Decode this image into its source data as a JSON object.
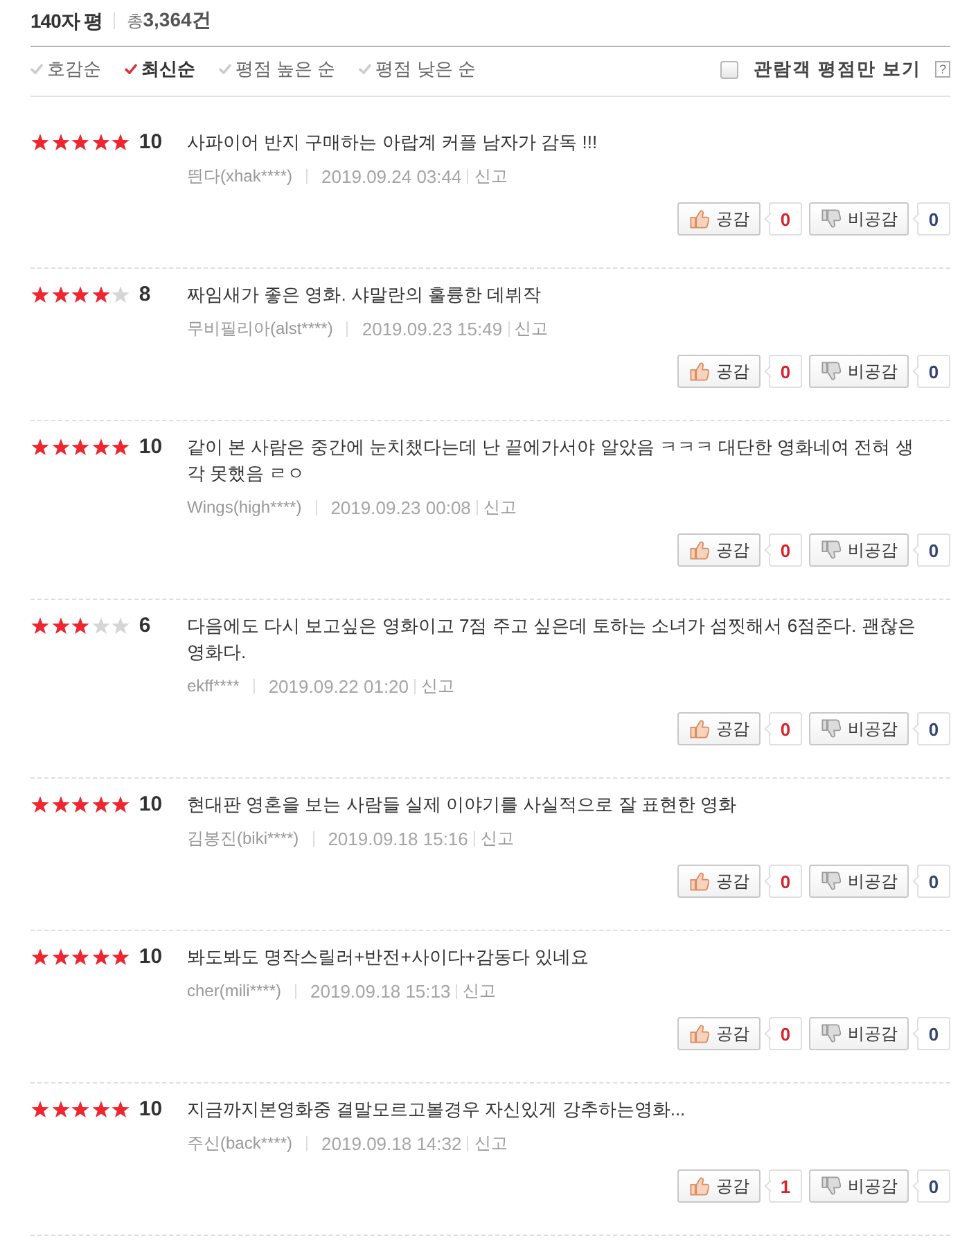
{
  "header": {
    "title": "140자 평",
    "total": "총**3,364건**"
  },
  "sort_options": [
    {
      "label": "호감순",
      "selected": false
    },
    {
      "label": "최신순",
      "selected": true
    },
    {
      "label": "평점 높은 순",
      "selected": false
    },
    {
      "label": "평점 낮은 순",
      "selected": false
    }
  ],
  "filter": {
    "label": "관람객 평점만 보기",
    "checked": false,
    "help": "?"
  },
  "reviews": [
    {
      "stars": 5,
      "score": "10",
      "text": "사파이어 반지 구매하는 아랍계 커플 남자가 감독 !!!",
      "author": "띈다(xhak****)",
      "date": "2019.09.24 03:44",
      "report": "신고",
      "like_label": "공감",
      "like_count": "0",
      "dislike_label": "비공감",
      "dislike_count": "0"
    },
    {
      "stars": 4,
      "score": "8",
      "text": "짜임새가 좋은 영화. 샤말란의 훌륭한 데뷔작",
      "author": "무비필리아(alst****)",
      "date": "2019.09.23 15:49",
      "report": "신고",
      "like_label": "공감",
      "like_count": "0",
      "dislike_label": "비공감",
      "dislike_count": "0"
    },
    {
      "stars": 5,
      "score": "10",
      "text": "같이 본 사람은 중간에 눈치챘다는데 난 끝에가서야 알았음 ㅋㅋㅋ 대단한 영화네여 전혀 생각 못했음 ㄹㅇ",
      "author": "Wings(high****)",
      "date": "2019.09.23 00:08",
      "report": "신고",
      "like_label": "공감",
      "like_count": "0",
      "dislike_label": "비공감",
      "dislike_count": "0"
    },
    {
      "stars": 3,
      "score": "6",
      "text": "다음에도 다시 보고싶은 영화이고 7점 주고 싶은데 토하는 소녀가 섬찟해서 6점준다. 괜찮은 영화다.",
      "author": "ekff****",
      "date": "2019.09.22 01:20",
      "report": "신고",
      "like_label": "공감",
      "like_count": "0",
      "dislike_label": "비공감",
      "dislike_count": "0"
    },
    {
      "stars": 5,
      "score": "10",
      "text": "현대판 영혼을 보는 사람들 실제 이야기를 사실적으로 잘 표현한 영화",
      "author": "김봉진(biki****)",
      "date": "2019.09.18 15:16",
      "report": "신고",
      "like_label": "공감",
      "like_count": "0",
      "dislike_label": "비공감",
      "dislike_count": "0"
    },
    {
      "stars": 5,
      "score": "10",
      "text": "봐도봐도 명작스릴러+반전+사이다+감동다 있네요",
      "author": "cher(mili****)",
      "date": "2019.09.18 15:13",
      "report": "신고",
      "like_label": "공감",
      "like_count": "0",
      "dislike_label": "비공감",
      "dislike_count": "0"
    },
    {
      "stars": 5,
      "score": "10",
      "text": "지금까지본영화중 결말모르고볼경우 자신있게 강추하는영화...",
      "author": "주신(back****)",
      "date": "2019.09.18 14:32",
      "report": "신고",
      "like_label": "공감",
      "like_count": "1",
      "dislike_label": "비공감",
      "dislike_count": "0"
    }
  ]
}
